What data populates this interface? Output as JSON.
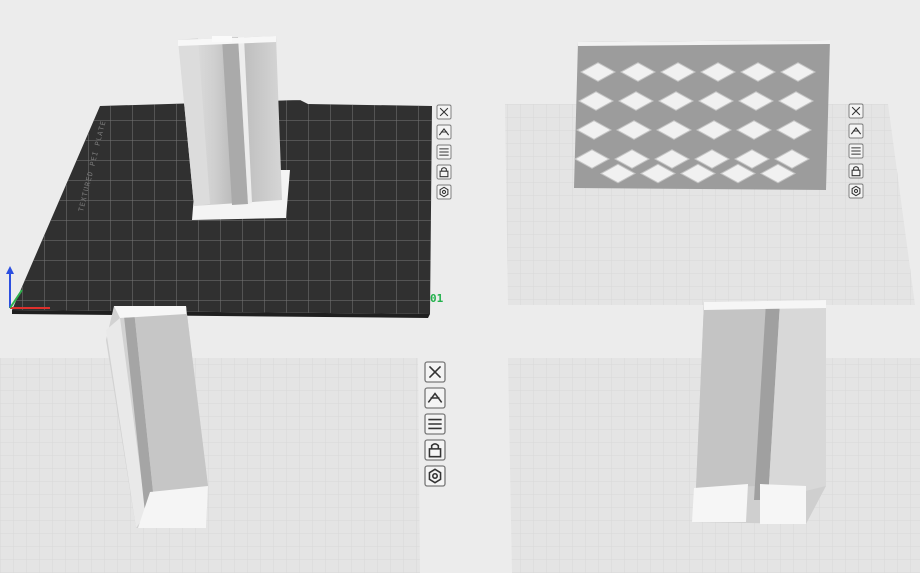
{
  "viewport": {
    "background": "#ececec",
    "grid_color": "#d6d6d6",
    "bed_color": "#3a3a3a",
    "bed_grid_color": "#6c6c6c",
    "part_color": "#cdcdcd",
    "part_highlight": "#f2f2f2",
    "part_shadow": "#a8a8a8"
  },
  "plates": [
    {
      "id": "plate-01",
      "label": "01",
      "state": "active",
      "bed_text": "TEXTURED PEI PLATE",
      "object": "vertical-bracket-on-plate",
      "toolbar": [
        "close-icon",
        "arrange-icon",
        "slice-plate-icon",
        "lock-icon",
        "settings-icon"
      ]
    },
    {
      "id": "plate-02",
      "label": "",
      "state": "inactive",
      "object": "lattice-panel",
      "toolbar": [
        "close-icon",
        "arrange-icon",
        "slice-plate-icon",
        "lock-icon",
        "settings-icon"
      ]
    },
    {
      "id": "plate-03",
      "label": "",
      "state": "inactive",
      "object": "vertical-bracket",
      "toolbar": [
        "close-icon",
        "arrange-icon",
        "slice-plate-icon",
        "lock-icon",
        "settings-icon"
      ]
    },
    {
      "id": "plate-04",
      "label": "",
      "state": "inactive",
      "object": "double-rail-bracket"
    }
  ],
  "axis": {
    "x_color": "#e0302c",
    "y_color": "#2fb14c",
    "z_color": "#2c4fe0"
  }
}
